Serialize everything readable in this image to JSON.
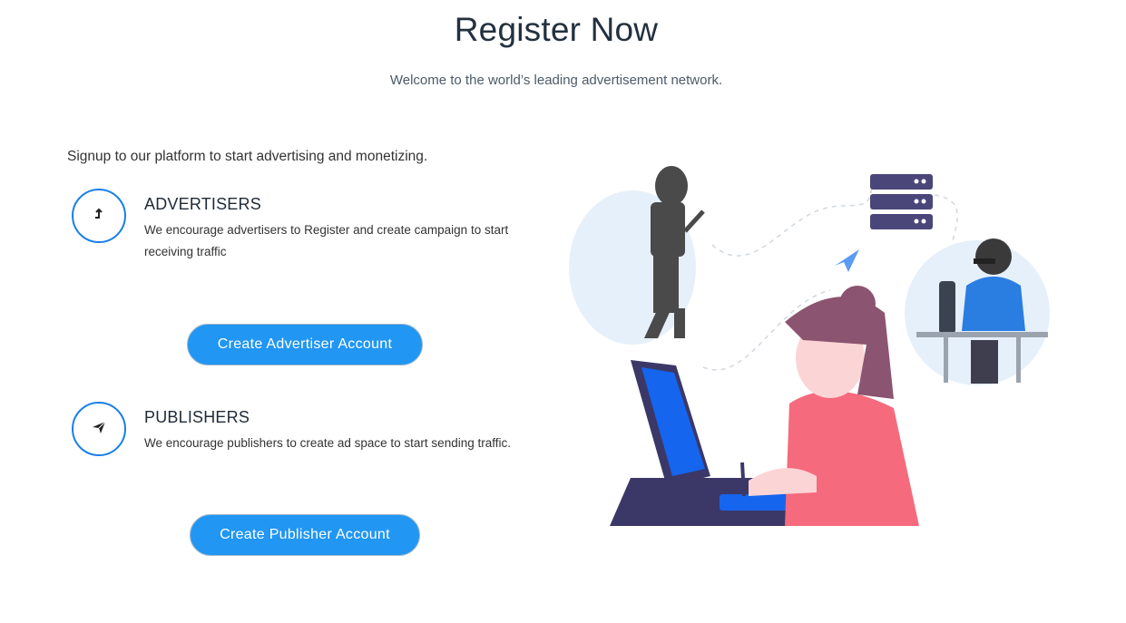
{
  "header": {
    "title": "Register Now",
    "subtitle": "Welcome to the world’s leading advertisement network."
  },
  "intro": "Signup to our platform to start advertising and monetizing.",
  "advertisers": {
    "icon": "arrow-up-right-icon",
    "heading": "ADVERTISERS",
    "description": "We encourage advertisers to Register and create campaign to start receiving traffic",
    "button_label": "Create Advertiser Account"
  },
  "publishers": {
    "icon": "paper-plane-icon",
    "heading": "PUBLISHERS",
    "description": "We encourage publishers to create ad space to start sending traffic.",
    "button_label": "Create Publisher Account"
  },
  "colors": {
    "accent": "#2196f3",
    "icon_ring": "#1a7fe8",
    "heading": "#23313f"
  }
}
